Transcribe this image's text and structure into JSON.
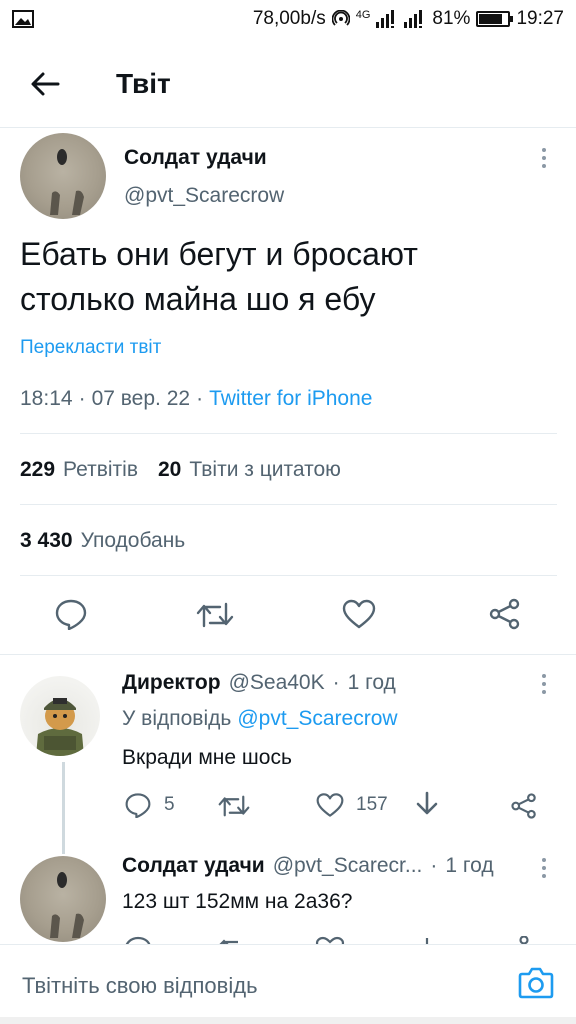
{
  "status_bar": {
    "speed": "78,00b/s",
    "network": "4G",
    "battery": "81%",
    "battery_level": 0.81,
    "time": "19:27"
  },
  "header": {
    "title": "Твіт"
  },
  "main_tweet": {
    "author_name": "Солдат удачи",
    "author_handle": "@pvt_Scarecrow",
    "text_line1": "Ебать они бегут и бросают",
    "text_line2": "столько майна шо я ебу",
    "translate": "Перекласти твіт",
    "time": "18:14",
    "date": "07 вер. 22",
    "sep": "·",
    "source": "Twitter for iPhone",
    "retweets_count": "229",
    "retweets_label": "Ретвітів",
    "quotes_count": "20",
    "quotes_label": "Твіти з цитатою",
    "likes_count": "3 430",
    "likes_label": "Уподобань"
  },
  "replies": [
    {
      "author_name": "Директор",
      "author_handle": "@Sea40K",
      "time": "1 год",
      "reply_to_label": "У відповідь",
      "reply_to_handle": "@pvt_Scarecrow",
      "text": "Вкради мне шось",
      "reply_count": "5",
      "like_count": "157"
    },
    {
      "author_name": "Солдат удачи",
      "author_handle": "@pvt_Scarecr...",
      "time": "1 год",
      "text": "123 шт 152мм на 2а36?"
    }
  ],
  "reply_bar": {
    "placeholder": "Твітніть свою відповідь"
  },
  "icons": [
    "back-arrow-icon",
    "more-icon",
    "reply-icon",
    "retweet-icon",
    "like-icon",
    "share-icon",
    "download-icon",
    "camera-icon"
  ],
  "colors": {
    "accent": "#1d9bf0",
    "text": "#0f1419",
    "muted": "#536471",
    "divider": "#e6ecf0"
  }
}
